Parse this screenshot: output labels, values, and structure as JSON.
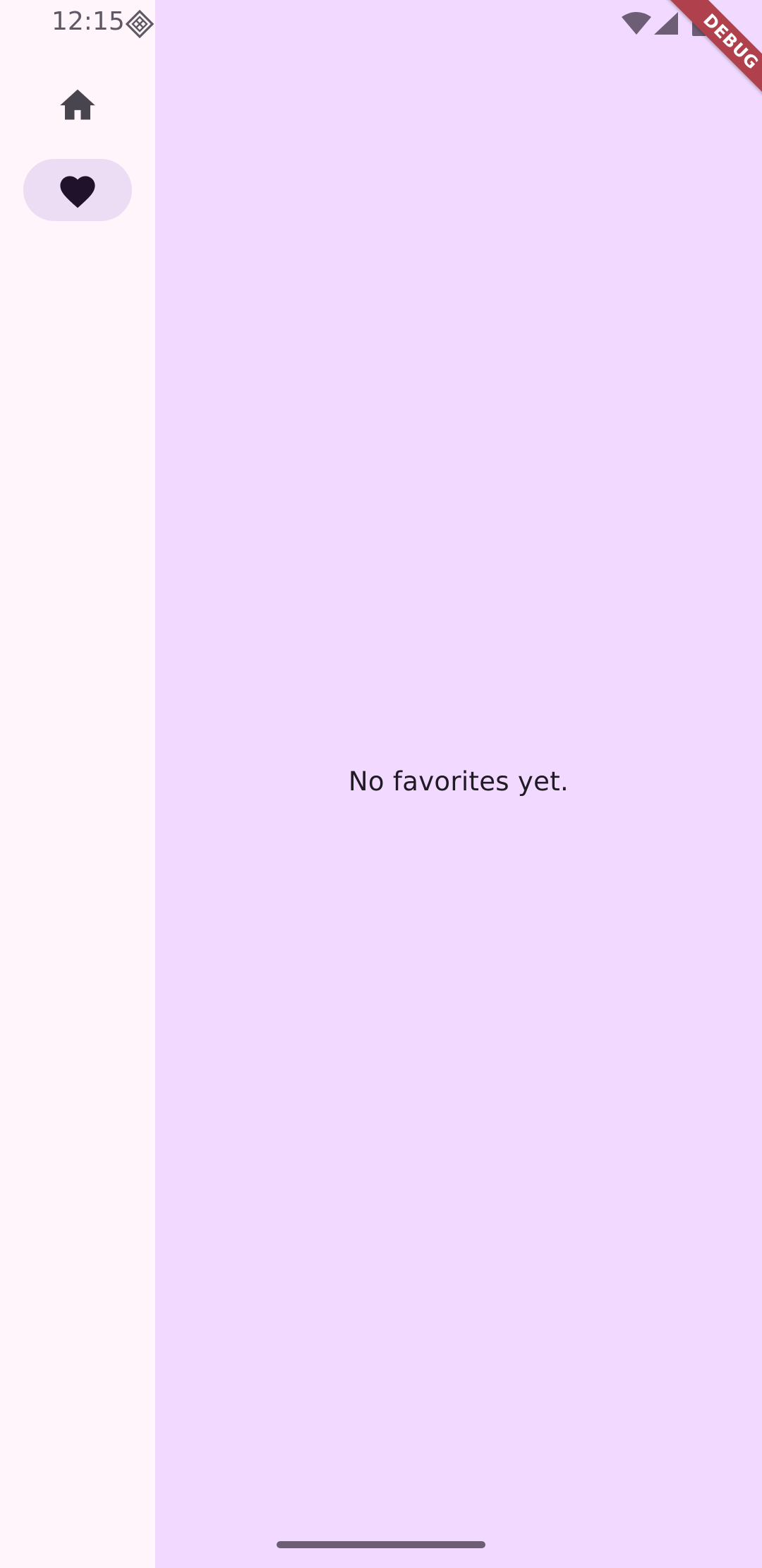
{
  "status_bar": {
    "time": "12:15",
    "notification_icon": "diamond-grid-icon",
    "wifi_icon": "wifi-icon",
    "signal_icon": "signal-icon",
    "battery_icon": "battery-icon"
  },
  "debug_banner": {
    "label": "DEBUG"
  },
  "nav_rail": {
    "items": [
      {
        "icon": "home-icon",
        "selected": false
      },
      {
        "icon": "heart-icon",
        "selected": true
      }
    ]
  },
  "main": {
    "empty_message": "No favorites yet."
  },
  "colors": {
    "rail_background": "#fff5fb",
    "content_background": "#f2d9ff",
    "selected_indicator": "#ecdcf4",
    "icon": "#49454f",
    "selected_icon": "#21122b",
    "text": "#1f1a23",
    "debug_banner": "#b0414c"
  }
}
